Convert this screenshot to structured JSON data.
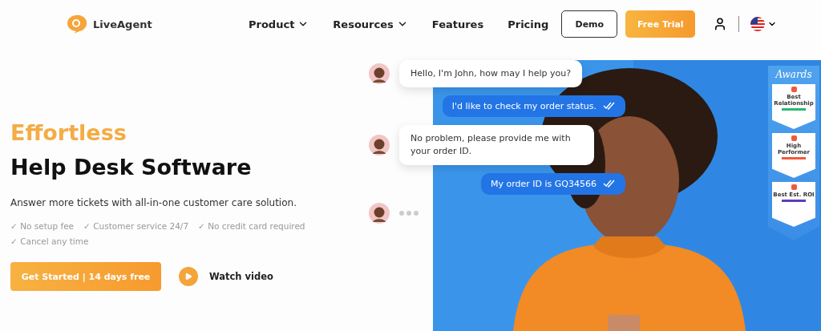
{
  "header": {
    "logo": "LiveAgent",
    "nav": [
      {
        "label": "Product",
        "dropdown": true
      },
      {
        "label": "Resources",
        "dropdown": true
      },
      {
        "label": "Features",
        "dropdown": false
      },
      {
        "label": "Pricing",
        "dropdown": false
      }
    ],
    "demo_button": "Demo",
    "trial_button": "Free Trial"
  },
  "hero": {
    "headline_accent": "Effortless",
    "headline": "Help Desk Software",
    "subtitle": "Answer more tickets with all-in-one customer care solution.",
    "benefits": [
      "✓ No setup fee",
      "✓ Customer service 24/7",
      "✓ No credit card required",
      "✓ Cancel any time"
    ],
    "cta_button": "Get Started | 14 days free",
    "video_link": "Watch video"
  },
  "chat": [
    {
      "kind": "agent",
      "text": "Hello, I'm John, how may I help you?"
    },
    {
      "kind": "user",
      "text": "I'd like to check my order status."
    },
    {
      "kind": "agent",
      "text": "No problem, please provide me with your order ID."
    },
    {
      "kind": "user",
      "text": "My order ID is GQ34566"
    },
    {
      "kind": "typing"
    }
  ],
  "awards": {
    "title": "Awards",
    "badges": [
      {
        "title": "Best Relationship",
        "color": "#2bb673"
      },
      {
        "title": "High Performer",
        "color": "#f05a3c"
      },
      {
        "title": "Best Est. ROI",
        "color": "#5b3fb5"
      }
    ]
  }
}
